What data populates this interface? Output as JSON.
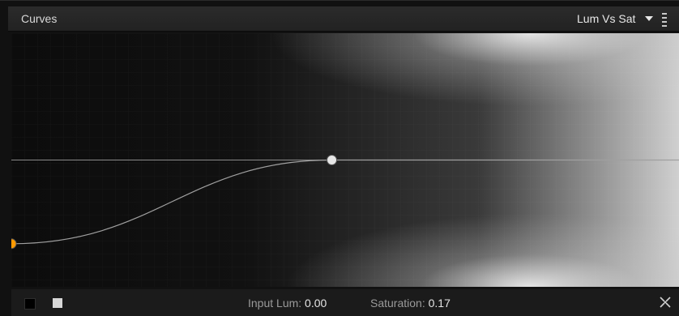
{
  "panel": {
    "title": "Curves",
    "mode_select": {
      "value": "Lum Vs Sat",
      "icon": "chevron-down-icon"
    },
    "menu_icon": "hamburger-menu-icon"
  },
  "curve": {
    "baseline_level": 0.5,
    "points": [
      {
        "input_lum": 0.0,
        "saturation": 0.17,
        "color": "#ff9a00",
        "selected": true
      },
      {
        "input_lum": 0.48,
        "saturation": 0.5,
        "color": "#e6e6e6",
        "selected": false
      }
    ],
    "line_color": "#a0a0a0"
  },
  "footer": {
    "black_swatch": "black-swatch",
    "white_swatch": "white-swatch",
    "input_label": "Input Lum:",
    "input_value": "0.00",
    "sat_label": "Saturation:",
    "sat_value": "0.17",
    "reset_icon": "reset-icon"
  },
  "colors": {
    "accent": "#ff9a00",
    "panel_bg": "#111111",
    "header_bg": "#262626",
    "footer_bg": "#1b1b1b"
  }
}
